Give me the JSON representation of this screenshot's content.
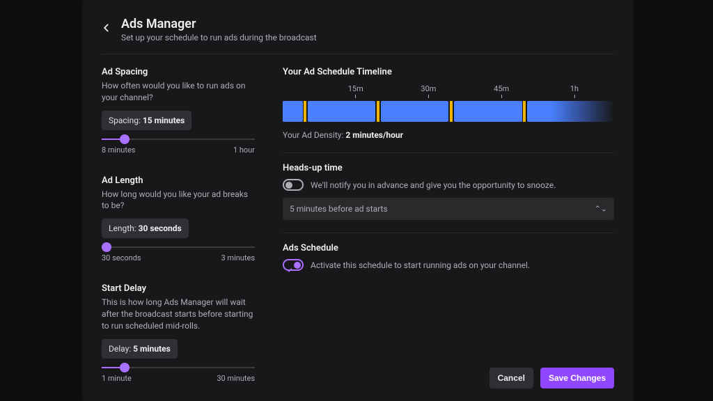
{
  "header": {
    "title": "Ads Manager",
    "subtitle": "Set up your schedule to run ads during the broadcast"
  },
  "spacing": {
    "title": "Ad Spacing",
    "desc": "How often would you like to run ads on your channel?",
    "pill_label": "Spacing: ",
    "pill_value": "15 minutes",
    "min_label": "8 minutes",
    "max_label": "1 hour",
    "slider_percent": 15
  },
  "length": {
    "title": "Ad Length",
    "desc": "How long would you like your ad breaks to be?",
    "pill_label": "Length: ",
    "pill_value": "30 seconds",
    "min_label": "30 seconds",
    "max_label": "3 minutes",
    "slider_percent": 3
  },
  "delay": {
    "title": "Start Delay",
    "desc": "This is how long Ads Manager will wait after the broadcast starts before starting to run scheduled mid-rolls.",
    "pill_label": "Delay: ",
    "pill_value": "5 minutes",
    "min_label": "1 minute",
    "max_label": "30 minutes",
    "slider_percent": 15
  },
  "timeline": {
    "title": "Your Ad Schedule Timeline",
    "ticks": [
      "15m",
      "30m",
      "45m",
      "1h"
    ],
    "density_label": "Your Ad Density: ",
    "density_value": "2 minutes/hour"
  },
  "headsup": {
    "title": "Heads-up time",
    "desc": "We'll notify you in advance and give you the opportunity to snooze.",
    "select_value": "5 minutes before ad starts",
    "enabled": false
  },
  "schedule": {
    "title": "Ads Schedule",
    "desc": "Activate this schedule to start running ads on your channel.",
    "enabled": true
  },
  "footer": {
    "cancel": "Cancel",
    "save": "Save Changes"
  }
}
